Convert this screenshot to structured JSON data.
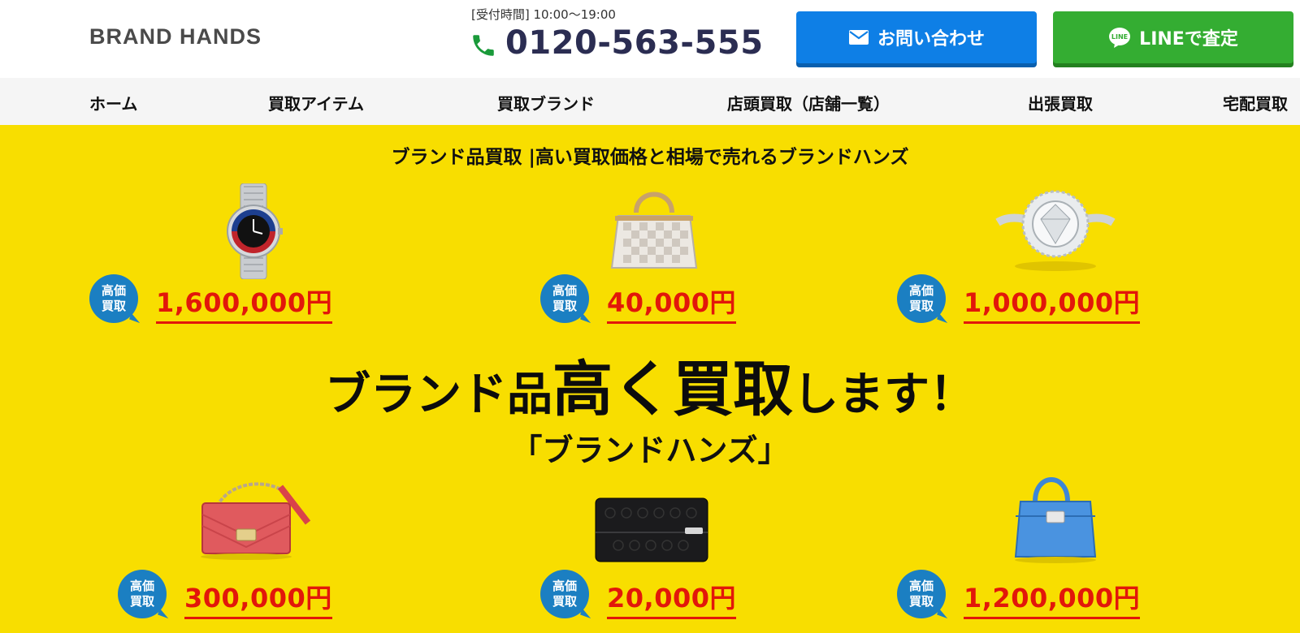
{
  "header": {
    "logo": "BRAND HANDS",
    "hours": "[受付時間] 10:00～19:00",
    "phone": "0120-563-555",
    "contact_button": "お問い合わせ",
    "line_button": "LINEで査定",
    "colors": {
      "contact": "#0e7fe6",
      "line": "#34ad32",
      "phone": "#2b2d52"
    }
  },
  "nav": {
    "items": [
      "ホーム",
      "買取アイテム",
      "買取ブランド",
      "店頭買取（店舗一覧）",
      "出張買取",
      "宅配買取"
    ]
  },
  "hero": {
    "subtitle": "ブランド品買取 |高い買取価格と相場で売れるブランドハンズ",
    "catch_part1": "ブランド品",
    "catch_part2": "高く買取",
    "catch_part3": "します！",
    "brand_name": "「ブランドハンズ」",
    "badge_line1": "高価",
    "badge_line2": "買取",
    "background": "#f8de00",
    "price_color": "#e2170a",
    "products": [
      {
        "icon": "watch-icon",
        "price": "1,600,000円"
      },
      {
        "icon": "handbag-icon",
        "price": "40,000円"
      },
      {
        "icon": "diamond-ring-icon",
        "price": "1,000,000円"
      },
      {
        "icon": "chain-bag-icon",
        "price": "300,000円"
      },
      {
        "icon": "wallet-icon",
        "price": "20,000円"
      },
      {
        "icon": "birkin-bag-icon",
        "price": "1,200,000円"
      }
    ]
  }
}
